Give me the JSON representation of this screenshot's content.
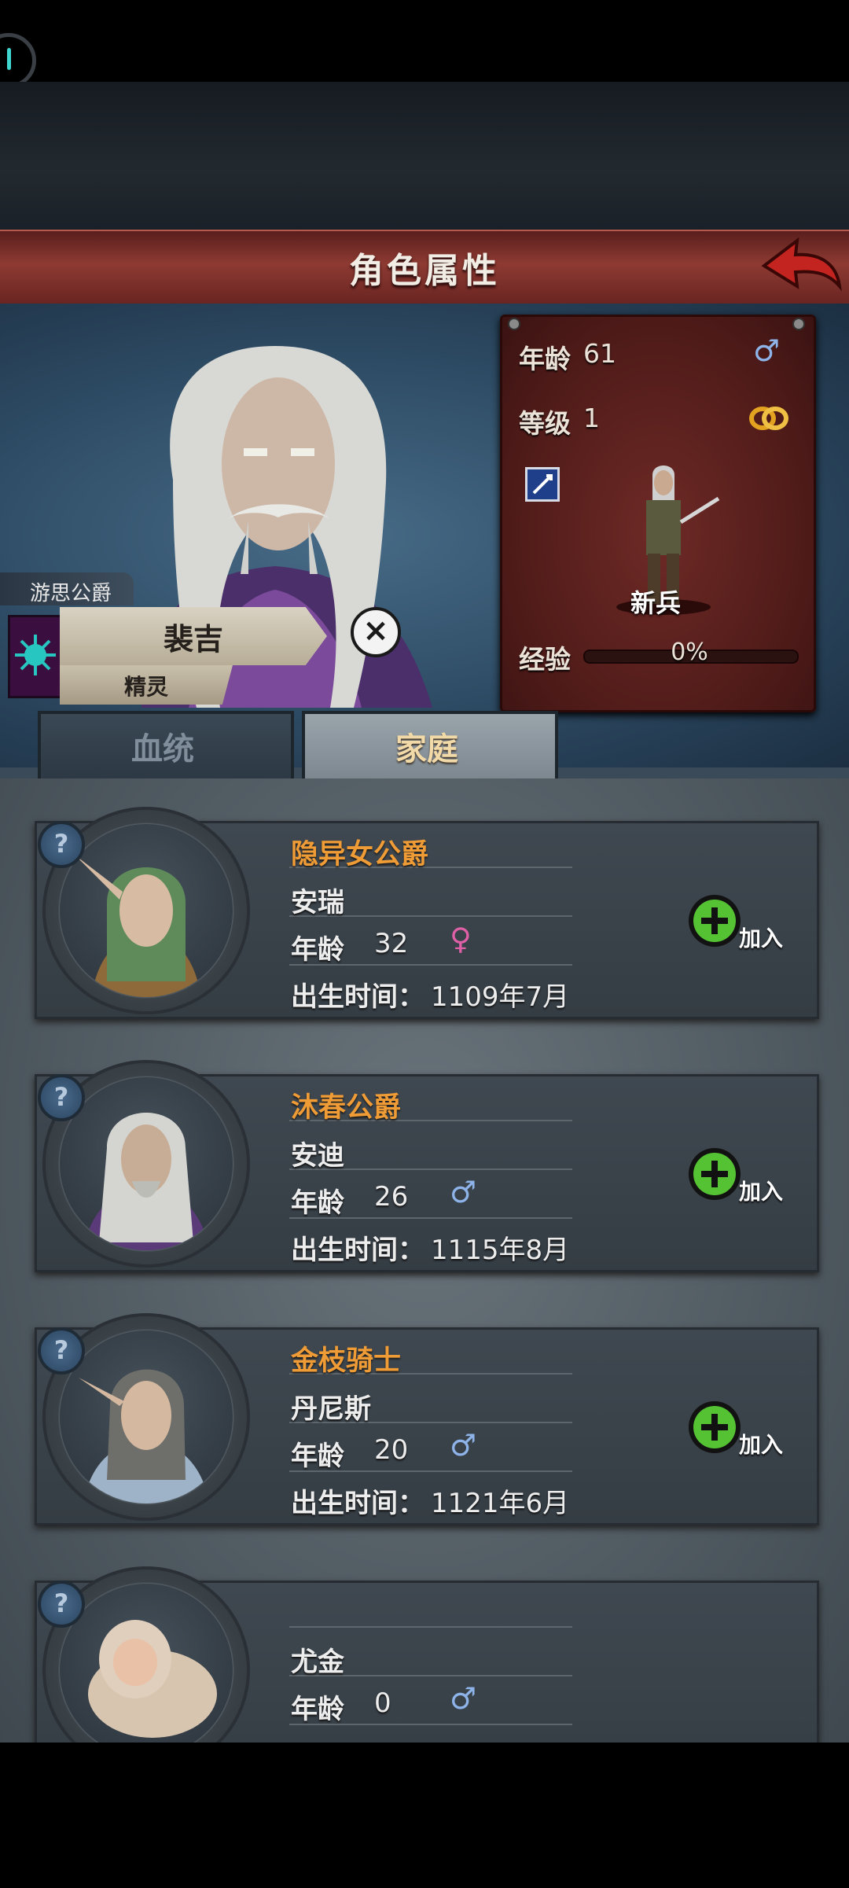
{
  "header": {
    "title": "角色属性"
  },
  "character": {
    "title": "游思公爵",
    "name": "裴吉",
    "race": "精灵",
    "stats": {
      "age_label": "年龄",
      "age_value": "61",
      "level_label": "等级",
      "level_value": "1",
      "exp_label": "经验",
      "exp_value": "0%",
      "exp_fraction": 0,
      "unit_class": "新兵"
    }
  },
  "tabs": [
    {
      "label": "血统",
      "selected": false
    },
    {
      "label": "家庭",
      "selected": true
    }
  ],
  "family": [
    {
      "title": "隐异女公爵",
      "name": "安瑞",
      "age_label": "年龄",
      "age": "32",
      "gender": "female",
      "gender_symbol": "♀",
      "birth_label": "出生时间：",
      "birth": "1109年7月",
      "add_label": "加入",
      "badge": "?"
    },
    {
      "title": "沐春公爵",
      "name": "安迪",
      "age_label": "年龄",
      "age": "26",
      "gender": "male",
      "gender_symbol": "♂",
      "birth_label": "出生时间：",
      "birth": "1115年8月",
      "add_label": "加入",
      "badge": "?"
    },
    {
      "title": "金枝骑士",
      "name": "丹尼斯",
      "age_label": "年龄",
      "age": "20",
      "gender": "male",
      "gender_symbol": "♂",
      "birth_label": "出生时间：",
      "birth": "1121年6月",
      "add_label": "加入",
      "badge": "?"
    },
    {
      "title": "",
      "name": "尤金",
      "age_label": "年龄",
      "age": "0",
      "gender": "male",
      "gender_symbol": "♂",
      "badge": "?"
    }
  ],
  "colors": {
    "title_bar": "#8d3a32",
    "accent_title": "#ef9b36",
    "add_green": "#54c233",
    "male": "#8db3e8",
    "female": "#e060a8"
  },
  "icons": {
    "back": "back-arrow-icon",
    "close": "close-icon",
    "gender_male": "male-icon",
    "gender_female": "female-icon",
    "ring": "ring-icon",
    "sword": "sword-skill-icon",
    "add": "plus-icon",
    "question": "question-icon",
    "faction": "faction-banner-icon"
  }
}
